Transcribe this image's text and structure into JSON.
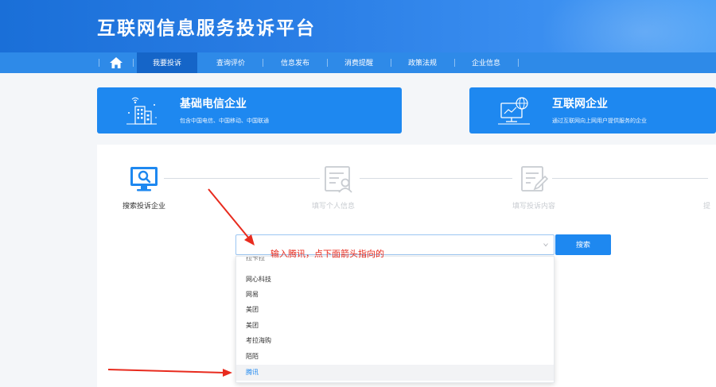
{
  "header": {
    "title": "互联网信息服务投诉平台"
  },
  "nav": {
    "items": [
      {
        "label": "我要投诉",
        "active": true
      },
      {
        "label": "查询评价"
      },
      {
        "label": "信息发布"
      },
      {
        "label": "消费提醒"
      },
      {
        "label": "政策法规"
      },
      {
        "label": "企业信息"
      }
    ]
  },
  "categories": [
    {
      "title": "基础电信企业",
      "desc": "包含中国电信、中国移动、中国联通"
    },
    {
      "title": "互联网企业",
      "desc": "通过互联网向上网用户提供服务的企业"
    }
  ],
  "steps": [
    {
      "label": "搜索投诉企业",
      "active": true
    },
    {
      "label": "填写个人信息"
    },
    {
      "label": "填写投诉内容"
    },
    {
      "label": "提"
    }
  ],
  "search": {
    "button_label": "搜索",
    "annotation": "输入腾讯，点下面箭头指向的"
  },
  "dropdown": {
    "items": [
      "拉卡拉",
      "网心科技",
      "网易",
      "美团",
      "美团",
      "考拉海购",
      "陌陌",
      "腾讯"
    ],
    "highlighted_index": 7
  },
  "colors": {
    "primary": "#1e88f0",
    "annotation": "#e82b1e",
    "nav_active": "#1565c8"
  }
}
